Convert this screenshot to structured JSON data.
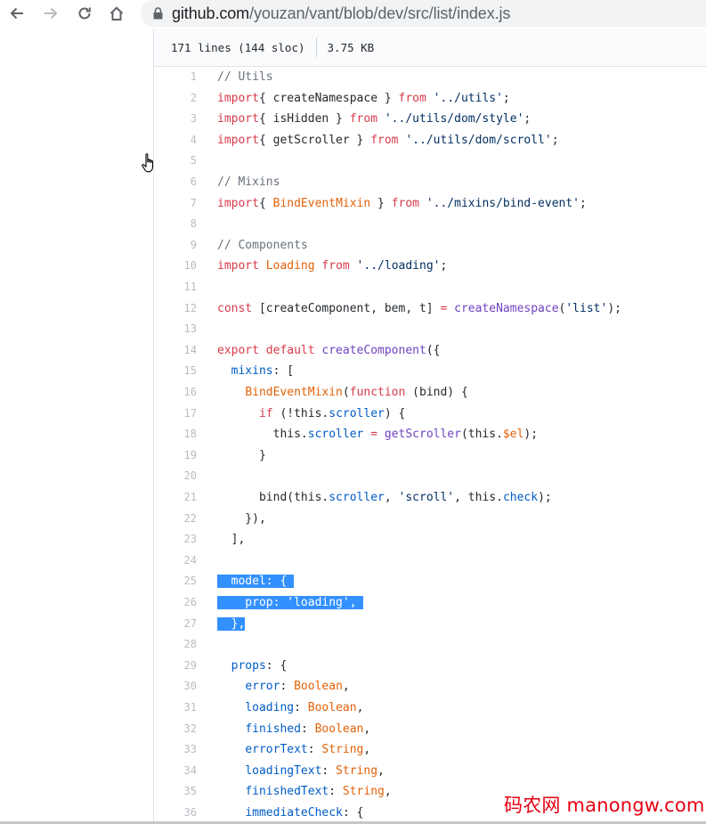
{
  "browser": {
    "url_host": "github.com",
    "url_path": "/youzan/vant/blob/dev/src/list/index.js"
  },
  "file": {
    "lines_info": "171 lines (144 sloc)",
    "size": "3.75 KB"
  },
  "code_lines": [
    {
      "n": "1",
      "segs": [
        [
          "c-com",
          "// Utils"
        ]
      ]
    },
    {
      "n": "2",
      "segs": [
        [
          "c-kw",
          "import"
        ],
        [
          "",
          "{ createNamespace } "
        ],
        [
          "c-kw",
          "from"
        ],
        [
          "c-str",
          " '../utils'"
        ],
        [
          "",
          ";"
        ]
      ]
    },
    {
      "n": "3",
      "segs": [
        [
          "c-kw",
          "import"
        ],
        [
          "",
          "{ isHidden } "
        ],
        [
          "c-kw",
          "from"
        ],
        [
          "c-str",
          " '../utils/dom/style'"
        ],
        [
          "",
          ";"
        ]
      ]
    },
    {
      "n": "4",
      "segs": [
        [
          "c-kw",
          "import"
        ],
        [
          "",
          "{ getScroller } "
        ],
        [
          "c-kw",
          "from"
        ],
        [
          "c-str",
          " '../utils/dom/scroll'"
        ],
        [
          "",
          ";"
        ]
      ]
    },
    {
      "n": "5",
      "segs": []
    },
    {
      "n": "6",
      "segs": [
        [
          "c-com",
          "// Mixins"
        ]
      ]
    },
    {
      "n": "7",
      "segs": [
        [
          "c-kw",
          "import"
        ],
        [
          "",
          "{ "
        ],
        [
          "c-cls",
          "BindEventMixin"
        ],
        [
          "",
          " } "
        ],
        [
          "c-kw",
          "from"
        ],
        [
          "c-str",
          " '../mixins/bind-event'"
        ],
        [
          "",
          ";"
        ]
      ]
    },
    {
      "n": "8",
      "segs": []
    },
    {
      "n": "9",
      "segs": [
        [
          "c-com",
          "// Components"
        ]
      ]
    },
    {
      "n": "10",
      "segs": [
        [
          "c-kw",
          "import"
        ],
        [
          "c-cls",
          " Loading "
        ],
        [
          "c-kw",
          "from"
        ],
        [
          "c-str",
          " '../loading'"
        ],
        [
          "",
          ";"
        ]
      ]
    },
    {
      "n": "11",
      "segs": []
    },
    {
      "n": "12",
      "segs": [
        [
          "c-kw",
          "const"
        ],
        [
          "",
          " [createComponent, bem, t] "
        ],
        [
          "c-kw",
          "="
        ],
        [
          "c-fn",
          " createNamespace"
        ],
        [
          "",
          "("
        ],
        [
          "c-str",
          "'list'"
        ],
        [
          "",
          ");"
        ]
      ]
    },
    {
      "n": "13",
      "segs": []
    },
    {
      "n": "14",
      "segs": [
        [
          "c-kw",
          "export default"
        ],
        [
          "c-fn",
          " createComponent"
        ],
        [
          "",
          "({"
        ]
      ]
    },
    {
      "n": "15",
      "segs": [
        [
          "",
          "  "
        ],
        [
          "c-prop",
          "mixins"
        ],
        [
          "",
          ": ["
        ]
      ]
    },
    {
      "n": "16",
      "segs": [
        [
          "",
          "    "
        ],
        [
          "c-cls",
          "BindEventMixin"
        ],
        [
          "",
          "("
        ],
        [
          "c-kw",
          "function"
        ],
        [
          "",
          " (bind) {"
        ]
      ]
    },
    {
      "n": "17",
      "segs": [
        [
          "",
          "      "
        ],
        [
          "c-kw",
          "if"
        ],
        [
          "",
          " (!this."
        ],
        [
          "c-prop",
          "scroller"
        ],
        [
          "",
          ") {"
        ]
      ]
    },
    {
      "n": "18",
      "segs": [
        [
          "",
          "        this."
        ],
        [
          "c-prop",
          "scroller"
        ],
        [
          "c-kw",
          " ="
        ],
        [
          "c-fn",
          " getScroller"
        ],
        [
          "",
          "(this."
        ],
        [
          "c-cls",
          "$el"
        ],
        [
          "",
          ");"
        ]
      ]
    },
    {
      "n": "19",
      "segs": [
        [
          "",
          "      }"
        ]
      ]
    },
    {
      "n": "20",
      "segs": []
    },
    {
      "n": "21",
      "segs": [
        [
          "",
          "      bind(this."
        ],
        [
          "c-prop",
          "scroller"
        ],
        [
          "",
          ", "
        ],
        [
          "c-str",
          "'scroll'"
        ],
        [
          "",
          ", this."
        ],
        [
          "c-prop",
          "check"
        ],
        [
          "",
          ");"
        ]
      ]
    },
    {
      "n": "22",
      "segs": [
        [
          "",
          "    }),"
        ]
      ]
    },
    {
      "n": "23",
      "segs": [
        [
          "",
          "  ],"
        ]
      ]
    },
    {
      "n": "24",
      "segs": []
    },
    {
      "n": "25",
      "segs": [
        [
          "sel",
          "  model: { "
        ]
      ]
    },
    {
      "n": "26",
      "segs": [
        [
          "sel",
          "    prop: 'loading', "
        ]
      ]
    },
    {
      "n": "27",
      "segs": [
        [
          "sel",
          "  },"
        ]
      ]
    },
    {
      "n": "28",
      "segs": []
    },
    {
      "n": "29",
      "segs": [
        [
          "",
          "  "
        ],
        [
          "c-prop",
          "props"
        ],
        [
          "",
          ": {"
        ]
      ]
    },
    {
      "n": "30",
      "segs": [
        [
          "",
          "    "
        ],
        [
          "c-prop",
          "error"
        ],
        [
          "",
          ": "
        ],
        [
          "c-cls",
          "Boolean"
        ],
        [
          "",
          ","
        ]
      ]
    },
    {
      "n": "31",
      "segs": [
        [
          "",
          "    "
        ],
        [
          "c-prop",
          "loading"
        ],
        [
          "",
          ": "
        ],
        [
          "c-cls",
          "Boolean"
        ],
        [
          "",
          ","
        ]
      ]
    },
    {
      "n": "32",
      "segs": [
        [
          "",
          "    "
        ],
        [
          "c-prop",
          "finished"
        ],
        [
          "",
          ": "
        ],
        [
          "c-cls",
          "Boolean"
        ],
        [
          "",
          ","
        ]
      ]
    },
    {
      "n": "33",
      "segs": [
        [
          "",
          "    "
        ],
        [
          "c-prop",
          "errorText"
        ],
        [
          "",
          ": "
        ],
        [
          "c-cls",
          "String"
        ],
        [
          "",
          ","
        ]
      ]
    },
    {
      "n": "34",
      "segs": [
        [
          "",
          "    "
        ],
        [
          "c-prop",
          "loadingText"
        ],
        [
          "",
          ": "
        ],
        [
          "c-cls",
          "String"
        ],
        [
          "",
          ","
        ]
      ]
    },
    {
      "n": "35",
      "segs": [
        [
          "",
          "    "
        ],
        [
          "c-prop",
          "finishedText"
        ],
        [
          "",
          ": "
        ],
        [
          "c-cls",
          "String"
        ],
        [
          "",
          ","
        ]
      ]
    },
    {
      "n": "36",
      "segs": [
        [
          "",
          "    "
        ],
        [
          "c-prop",
          "immediateCheck"
        ],
        [
          "",
          ": {"
        ]
      ]
    }
  ],
  "watermark": "码农网 manongw.com",
  "colors": {
    "selection": "#3391ff",
    "keyword": "#d73a49",
    "watermark": "#e60012"
  }
}
